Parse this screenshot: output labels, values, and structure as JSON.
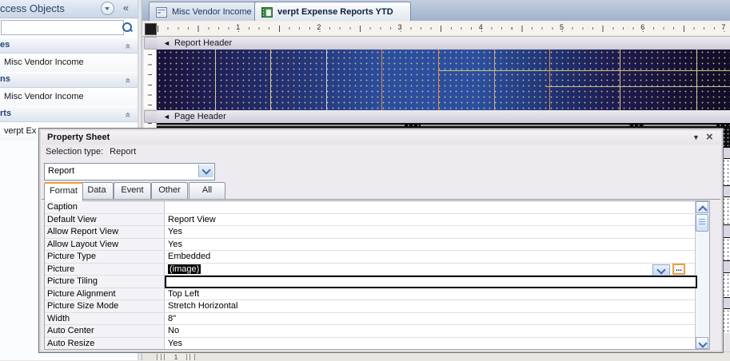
{
  "sidebar": {
    "title": "ccess Objects",
    "search_value": "",
    "sections": [
      {
        "label": "es",
        "items": [
          "Misc Vendor Income"
        ]
      },
      {
        "label": "ns",
        "items": [
          "Misc Vendor Income"
        ]
      },
      {
        "label": "rts",
        "items": [
          "verpt Ex"
        ]
      }
    ]
  },
  "tabs": [
    {
      "label": "Misc Vendor Income",
      "active": false
    },
    {
      "label": "verpt Expense Reports YTD",
      "active": true
    }
  ],
  "design": {
    "ruler_numbers": [
      "1",
      "2",
      "3",
      "4",
      "5",
      "6",
      "7"
    ],
    "sections": [
      {
        "label": "Report Header"
      },
      {
        "label": "Page Header"
      }
    ],
    "bottom_fragment": "1"
  },
  "property_sheet": {
    "title": "Property Sheet",
    "selection_type_label": "Selection type:",
    "selection_type_value": "Report",
    "selector_value": "Report",
    "tabs": [
      "Format",
      "Data",
      "Event",
      "Other",
      "All"
    ],
    "active_tab": "Format",
    "builder_label": "...",
    "rows": [
      {
        "label": "Caption",
        "value": ""
      },
      {
        "label": "Default View",
        "value": "Report View"
      },
      {
        "label": "Allow Report View",
        "value": "Yes"
      },
      {
        "label": "Allow Layout View",
        "value": "Yes"
      },
      {
        "label": "Picture Type",
        "value": "Embedded"
      },
      {
        "label": "Picture",
        "value": "(image)",
        "selected": true,
        "has_dropdown": true,
        "has_builder": true
      },
      {
        "label": "Picture Tiling",
        "value": "",
        "editing": true
      },
      {
        "label": "Picture Alignment",
        "value": "Top Left"
      },
      {
        "label": "Picture Size Mode",
        "value": "Stretch Horizontal"
      },
      {
        "label": "Width",
        "value": "8\""
      },
      {
        "label": "Auto Center",
        "value": "No"
      },
      {
        "label": "Auto Resize",
        "value": "Yes"
      }
    ]
  },
  "icons": {
    "menu_arrow_glyph": "▼",
    "close_glyph": "×",
    "section_arrow_glyph": "◄",
    "pane_collapse_glyph": "«",
    "section_collapse_glyph": "«"
  },
  "colors": {
    "accent_orange": "#f09d3c",
    "grid_blue": "#2b4f9e",
    "grid_dark": "#17123a",
    "selection_bg": "#000000",
    "nav_header_navy": "#27416b",
    "tabbar_blue": "#a9bad2"
  }
}
